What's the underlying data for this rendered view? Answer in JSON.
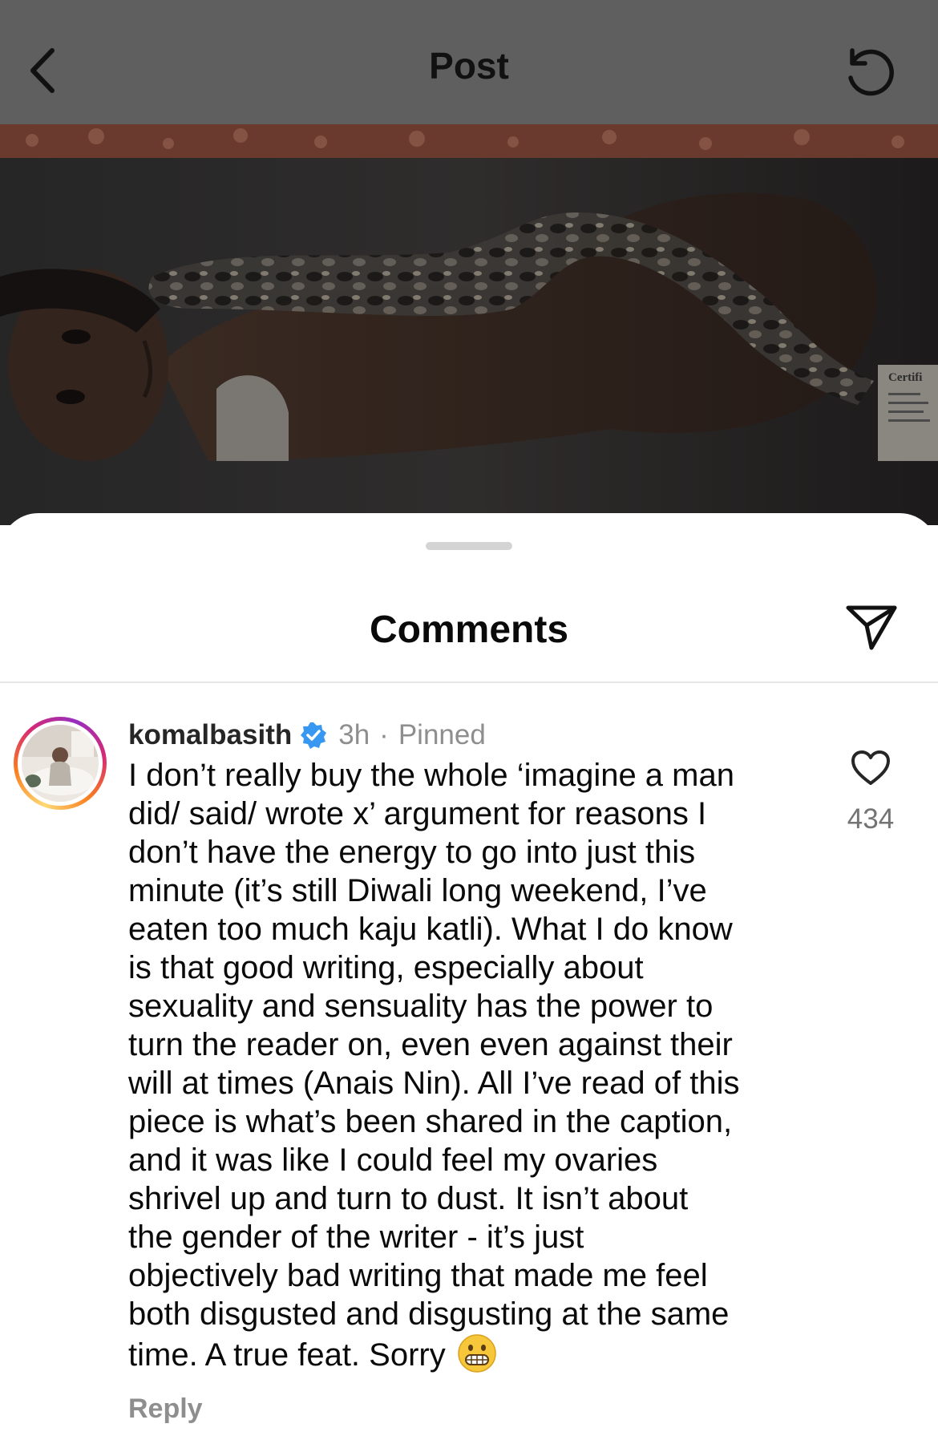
{
  "header": {
    "title": "Post",
    "back_icon": "chevron-left-icon",
    "refresh_icon": "refresh-icon"
  },
  "photo": {
    "overlay_label": "Certifi"
  },
  "sheet": {
    "title": "Comments",
    "share_icon": "send-icon"
  },
  "comment": {
    "username": "komalbasith",
    "verified_icon": "verified-badge-icon",
    "time": "3h",
    "separator": "·",
    "pinned_label": "Pinned",
    "lines": [
      "I don’t really buy the whole ‘imagine a man",
      "did/ said/ wrote x’ argument for reasons I",
      "don’t have the energy to go into just this",
      "minute (it’s still Diwali long weekend, I’ve",
      "eaten too much kaju katli). What I do know",
      "is that good writing, especially about",
      "sexuality and sensuality has the power to",
      "turn the reader on, even even against their",
      "will at times (Anais Nin). All I’ve read of this",
      "piece is what’s been shared in the caption,",
      "and it was like I could feel my ovaries",
      "shrivel up and turn to dust. It isn’t about",
      "the gender of the writer - it’s just",
      "objectively bad writing that made me feel",
      "both disgusted and disgusting at the same",
      "time. A true feat. Sorry"
    ],
    "emoji": "grimacing-face-emoji",
    "like_count": "434",
    "reply_label": "Reply"
  },
  "colors": {
    "header_dim": "#5f5f5f",
    "verified_blue": "#3897f0",
    "muted_text": "#8e8e8e"
  }
}
